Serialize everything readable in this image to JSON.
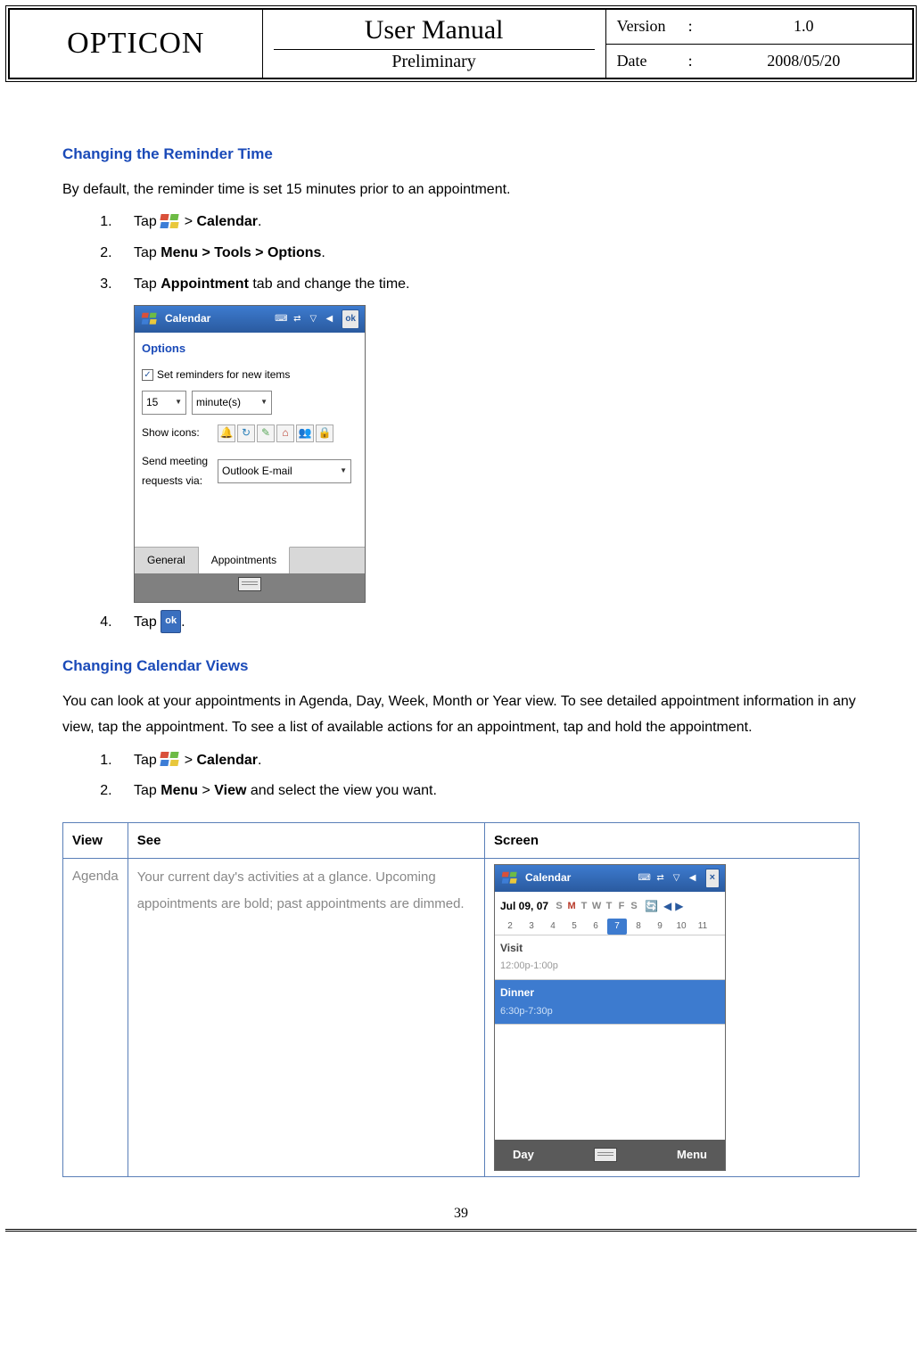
{
  "header": {
    "brand": "OPTICON",
    "title": "User Manual",
    "subtitle": "Preliminary",
    "version_label": "Version",
    "version_value": "1.0",
    "date_label": "Date",
    "date_value": "2008/05/20"
  },
  "section1": {
    "title": "Changing the Reminder Time",
    "intro": "By default, the reminder time is set 15 minutes prior to an appointment.",
    "step1_pre": "Tap ",
    "step1_post": " > ",
    "step1_bold": "Calendar",
    "step1_end": ".",
    "step2_pre": "Tap ",
    "step2_bold": "Menu > Tools > Options",
    "step2_end": ".",
    "step3_pre": "Tap ",
    "step3_bold": "Appointment",
    "step3_post": " tab and change the time.",
    "step4_pre": "Tap ",
    "step4_end": "."
  },
  "device1": {
    "title": "Calendar",
    "options_heading": "Options",
    "checkbox_label": "Set reminders for new items",
    "reminder_value": "15",
    "reminder_unit": "minute(s)",
    "show_icons_label": "Show icons:",
    "send_via_label": "Send meeting requests via:",
    "email_value": "Outlook E-mail",
    "tab_general": "General",
    "tab_appointments": "Appointments",
    "ok": "ok"
  },
  "section2": {
    "title": "Changing Calendar Views",
    "intro": "You can look at your appointments in Agenda, Day, Week, Month or Year view. To see detailed appointment information in any view, tap the appointment. To see a list of available actions for an appointment, tap and hold the appointment.",
    "step1_pre": "Tap ",
    "step1_post": " > ",
    "step1_bold": "Calendar",
    "step1_end": ".",
    "step2_pre": "Tap ",
    "step2_bold1": "Menu",
    "step2_mid": " > ",
    "step2_bold2": "View",
    "step2_post": " and select the view you want."
  },
  "table": {
    "col_view": "View",
    "col_see": "See",
    "col_screen": "Screen",
    "agenda_label": "Agenda",
    "agenda_desc": "Your current day's activities at a glance. Upcoming appointments are bold; past appointments are dimmed."
  },
  "device2": {
    "title": "Calendar",
    "date": "Jul  09, 07",
    "week_letters": [
      "S",
      "M",
      "T",
      "W",
      "T",
      "F",
      "S"
    ],
    "day_nums": [
      "2",
      "3",
      "4",
      "5",
      "6",
      "7",
      "8",
      "9",
      "10",
      "11"
    ],
    "today_index": 5,
    "appt1_title": "Visit",
    "appt1_time": "12:00p-1:00p",
    "appt2_title": "Dinner",
    "appt2_time": "6:30p-7:30p",
    "softkey_left": "Day",
    "softkey_right": "Menu"
  },
  "page_number": "39",
  "ok_label": "ok"
}
